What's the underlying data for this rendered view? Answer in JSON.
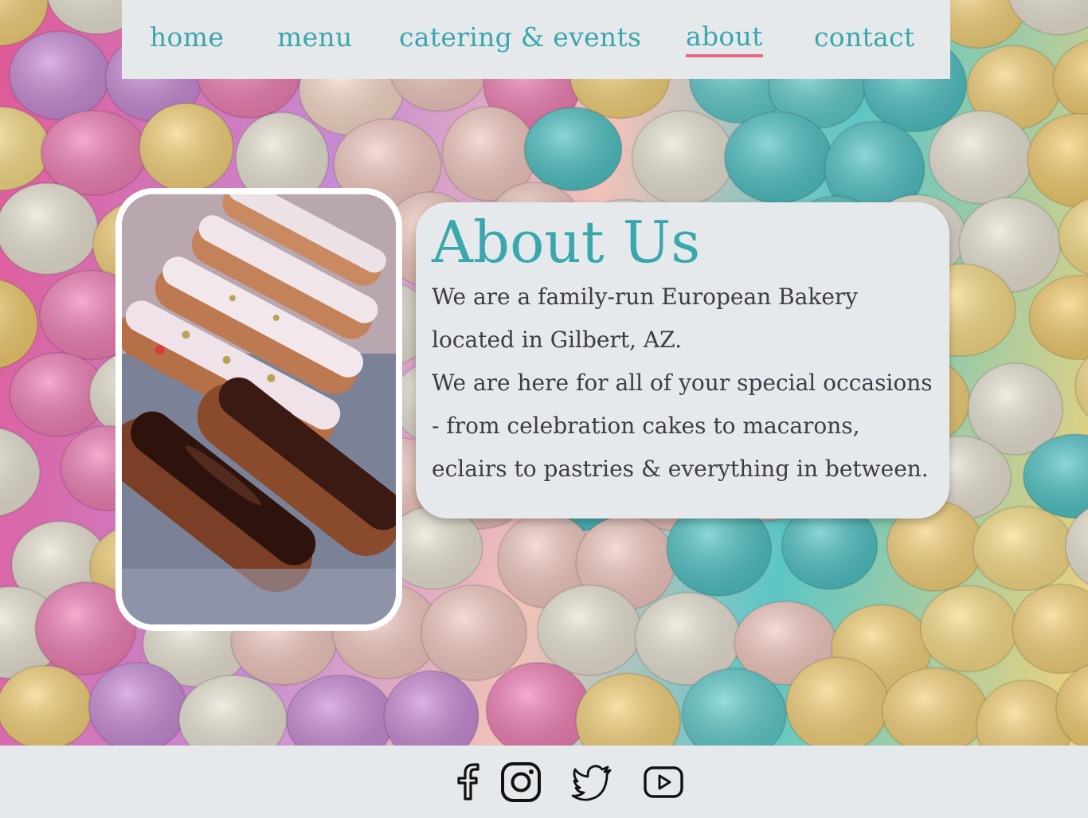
{
  "nav": {
    "links": [
      {
        "label": "home",
        "active": false
      },
      {
        "label": "menu",
        "active": false
      },
      {
        "label": "catering & events",
        "active": false
      },
      {
        "label": "about",
        "active": true
      },
      {
        "label": "contact",
        "active": false
      }
    ]
  },
  "about": {
    "title": "About Us",
    "paragraph_1": "We are a family-run European Bakery located in Gilbert, AZ.",
    "paragraph_2": "We are here for all of your special occasions - from celebration cakes to macarons, eclairs to pastries & everything in between."
  },
  "footer": {
    "social": [
      {
        "icon": "facebook-icon"
      },
      {
        "icon": "instagram-icon"
      },
      {
        "icon": "twitter-icon"
      },
      {
        "icon": "youtube-icon"
      }
    ]
  },
  "colors": {
    "accent": "#3aa7ad",
    "active_underline": "#ea6a8c",
    "panel": "#e6e9ec",
    "body_text": "#3c3c46"
  }
}
